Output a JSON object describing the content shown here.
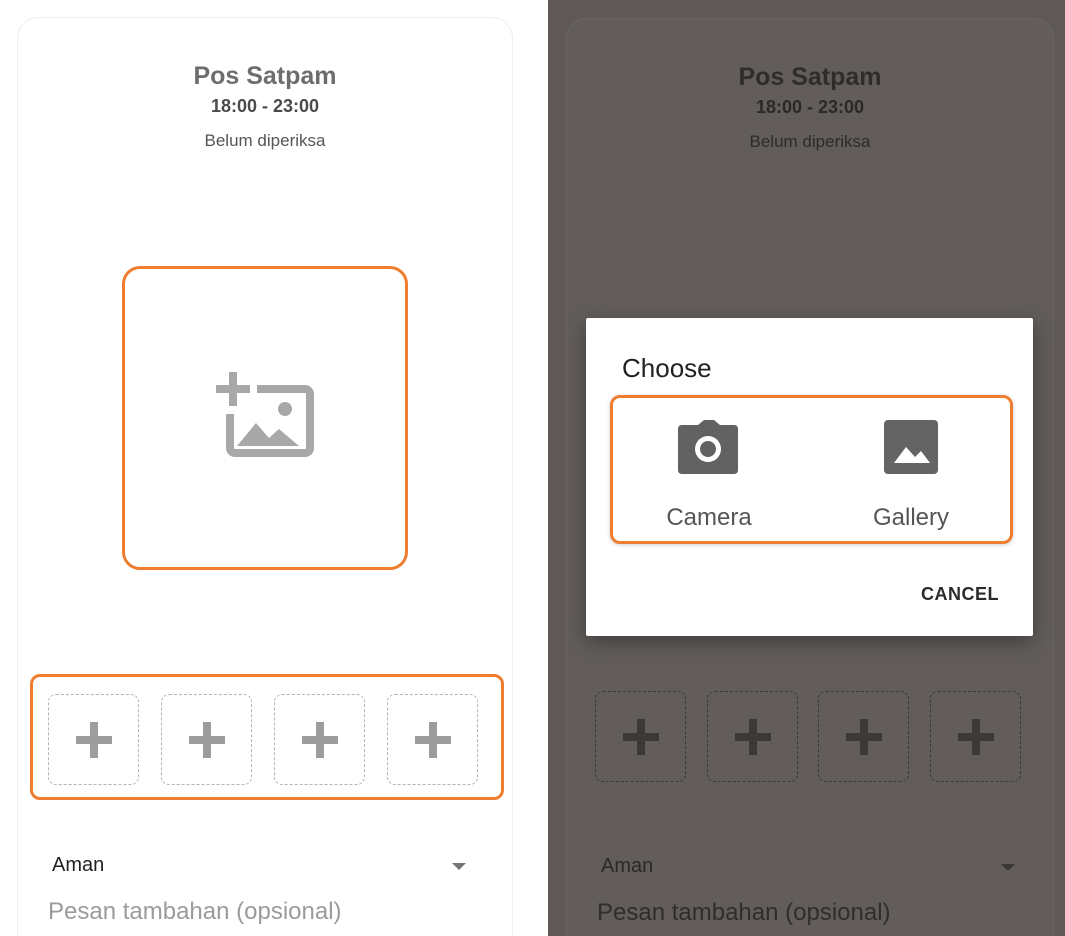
{
  "screen": {
    "title": "Pos Satpam",
    "time_range": "18:00 - 23:00",
    "status": "Belum diperiksa"
  },
  "photo": {
    "icon": "add-photo-icon"
  },
  "thumbnails": [
    {
      "icon": "plus-icon"
    },
    {
      "icon": "plus-icon"
    },
    {
      "icon": "plus-icon"
    },
    {
      "icon": "plus-icon"
    }
  ],
  "form": {
    "selected_status": "Aman",
    "message_placeholder": "Pesan tambahan (opsional)"
  },
  "dialog": {
    "title": "Choose",
    "options": [
      {
        "label": "Camera",
        "icon": "camera-icon"
      },
      {
        "label": "Gallery",
        "icon": "gallery-icon"
      }
    ],
    "cancel_label": "CANCEL"
  },
  "colors": {
    "accent": "#ee7d2f",
    "overlay": "#5e5856",
    "icon_gray": "#9d9d9d"
  }
}
